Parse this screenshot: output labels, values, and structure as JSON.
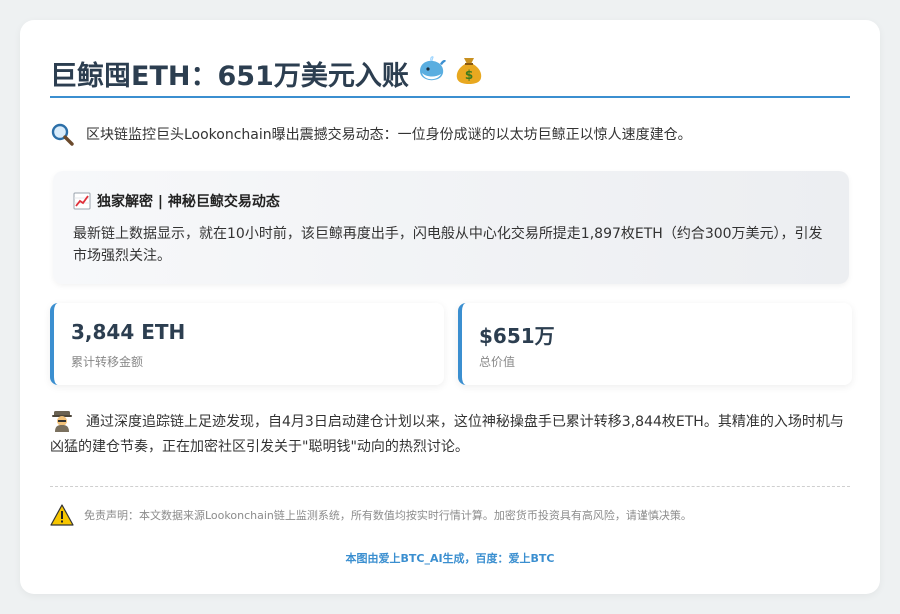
{
  "header": {
    "title": "巨鲸囤ETH：651万美元入账",
    "title_emojis": [
      "whale-icon",
      "money-bag-icon"
    ]
  },
  "intro": {
    "icon": "magnifier-icon",
    "text": "区块链监控巨头Lookonchain曝出震撼交易动态：一位身份成谜的以太坊巨鲸正以惊人速度建仓。"
  },
  "highlight": {
    "icon": "chart-increasing-icon",
    "title": "独家解密 | 神秘巨鲸交易动态",
    "body": "最新链上数据显示，就在10小时前，该巨鲸再度出手，闪电般从中心化交易所提走1,897枚ETH（约合300万美元），引发市场强烈关注。"
  },
  "stats": [
    {
      "value": "3,844 ETH",
      "label": "累计转移金额"
    },
    {
      "value": "$651万",
      "label": "总价值"
    }
  ],
  "analysis": {
    "icon": "detective-icon",
    "text": "通过深度追踪链上足迹发现，自4月3日启动建仓计划以来，这位神秘操盘手已累计转移3,844枚ETH。其精准的入场时机与凶猛的建仓节奏，正在加密社区引发关于\"聪明钱\"动向的热烈讨论。"
  },
  "disclaimer": {
    "icon": "warning-icon",
    "text": "免责声明：本文数据来源Lookonchain链上监测系统，所有数值均按实时行情计算。加密货币投资具有高风险，请谨慎决策。"
  },
  "footer": {
    "text": "本图由爱上BTC_AI生成，百度：爱上BTC"
  },
  "colors": {
    "accent": "#3b8fd0",
    "title": "#2c3e50",
    "background": "#eef1f2"
  }
}
